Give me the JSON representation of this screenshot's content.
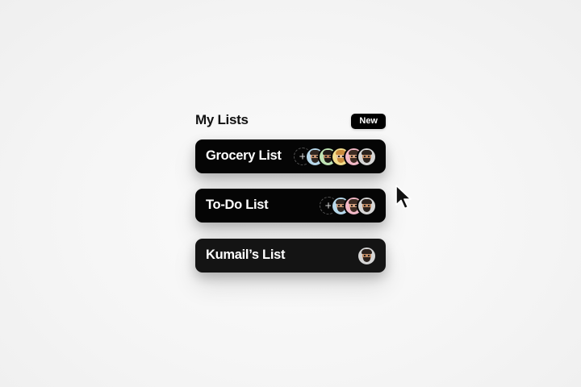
{
  "header": {
    "title": "My Lists",
    "new_button_label": "New"
  },
  "lists": [
    {
      "label": "Grocery List",
      "add_icon": "+",
      "members": [
        {
          "avatar_bg": "#b7d8ea",
          "skin": "#c49472",
          "hair": "#2e2520"
        },
        {
          "avatar_bg": "#bfe3b4",
          "skin": "#b07c5a",
          "hair": "#1f1a17"
        },
        {
          "avatar_bg": "#f3dd8e",
          "skin": "#e8c29d",
          "hair": "#c98b3c"
        },
        {
          "avatar_bg": "#f2b8c6",
          "skin": "#d4a07e",
          "hair": "#3d2b22"
        },
        {
          "avatar_bg": "#d5d5d5",
          "skin": "#c08a63",
          "hair": "#2a211c"
        }
      ]
    },
    {
      "label": "To-Do List",
      "add_icon": "+",
      "members": [
        {
          "avatar_bg": "#b7d8ea",
          "skin": "#c49472",
          "hair": "#2e2520"
        },
        {
          "avatar_bg": "#f2b8c6",
          "skin": "#d4a07e",
          "hair": "#3d2b22"
        },
        {
          "avatar_bg": "#d5d5d5",
          "skin": "#c08a63",
          "hair": "#2a211c"
        }
      ]
    },
    {
      "label": "Kumail’s List",
      "members": [
        {
          "avatar_bg": "#d5d5d5",
          "skin": "#c08a63",
          "hair": "#2a211c"
        }
      ]
    }
  ],
  "colors": {
    "card_background": "#050505",
    "page_background": "#f5f5f5",
    "accent": "#000000"
  },
  "icons": {
    "add_member": "plus-icon",
    "avatar": "memoji-avatar",
    "pointer": "mouse-pointer-icon"
  }
}
